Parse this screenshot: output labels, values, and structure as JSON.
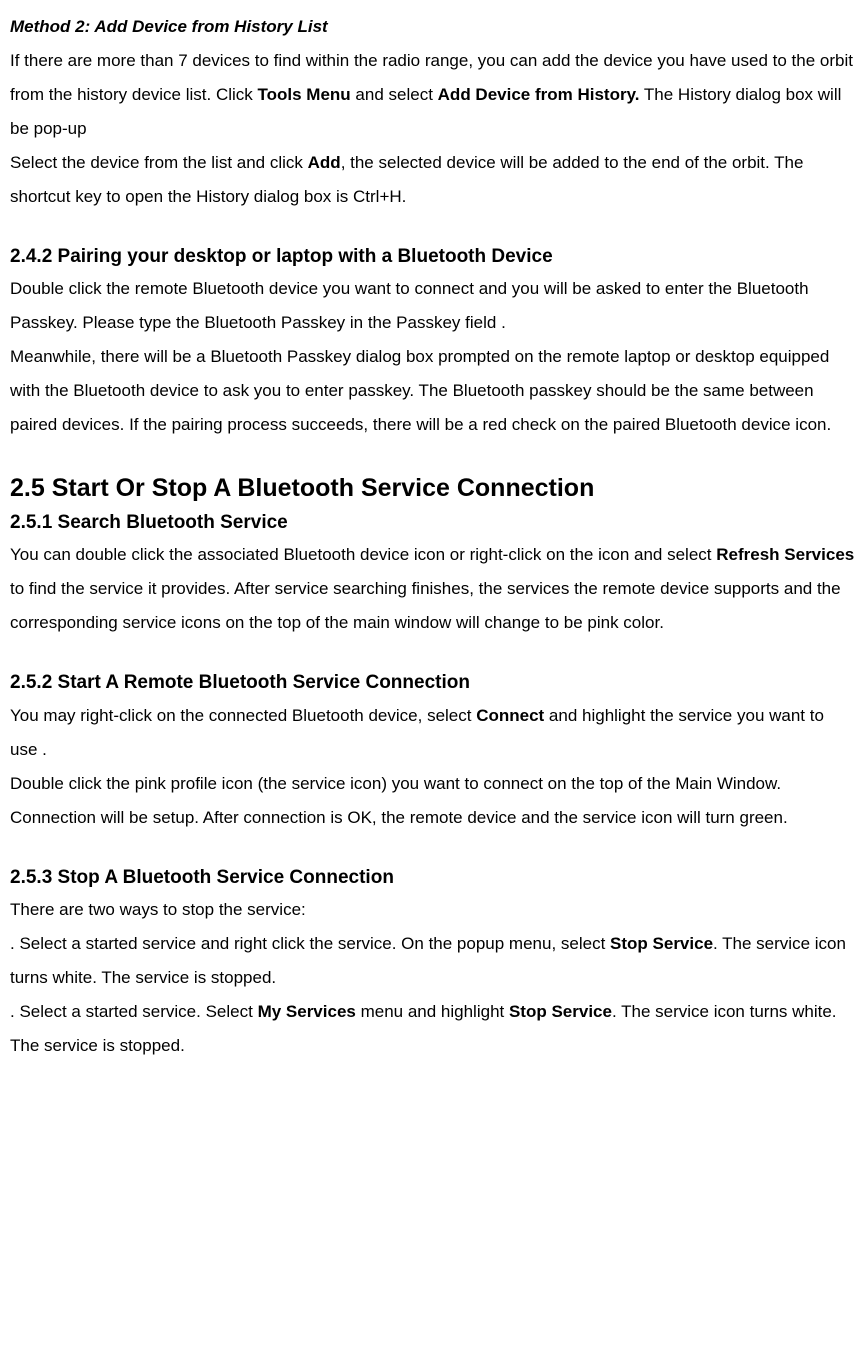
{
  "doc": {
    "method2_h": "Method 2: Add Device from History List",
    "method2_p1_a": "If there are more than 7 devices to find within the radio range, you can add the device you have used to the orbit from the history device list. Click ",
    "method2_p1_b": "Tools Menu",
    "method2_p1_c": " and select ",
    "method2_p1_d": "Add Device from History.",
    "method2_p1_e": " The History dialog box will be pop-up",
    "method2_p2_a": "Select the device from the list and click ",
    "method2_p2_b": "Add",
    "method2_p2_c": ", the selected device will be added to the end of the orbit. The shortcut key to open the History dialog box is Ctrl+H.",
    "s242_h": "2.4.2 Pairing your desktop or laptop with a Bluetooth Device",
    "s242_p1": "Double click the remote Bluetooth device you want to connect and you will be asked to enter the Bluetooth Passkey. Please type the Bluetooth Passkey in the Passkey field .",
    "s242_p2": "Meanwhile, there will be a Bluetooth Passkey dialog box prompted on the remote laptop or desktop equipped with the Bluetooth device to ask you to enter passkey. The Bluetooth passkey should be the same between paired devices. If the pairing process succeeds, there will be a red check on the paired Bluetooth device icon.",
    "s25_h": "2.5 Start Or Stop A Bluetooth Service Connection",
    "s251_h": "2.5.1 Search Bluetooth Service",
    "s251_p1_a": "You can double click the associated Bluetooth device icon or right-click on the icon and select ",
    "s251_p1_b": "Refresh Services",
    "s251_p1_c": " to find the service it provides. After service searching finishes, the services the remote device supports and the corresponding service icons on the top of the main window will change to be pink color.",
    "s252_h": "2.5.2 Start A Remote Bluetooth Service Connection",
    "s252_p1_a": "You may right-click on the connected Bluetooth device, select ",
    "s252_p1_b": "Connect",
    "s252_p1_c": " and highlight the service you want to use .",
    "s252_p2": "Double click the pink profile icon (the service icon) you want to connect on the top of the Main Window.",
    "s252_p3": "Connection will be setup. After connection is OK, the remote device and the service icon will turn green.",
    "s253_h": "2.5.3 Stop A Bluetooth Service Connection",
    "s253_p1": "There are two ways to stop the service:",
    "s253_li1_a": ".  Select a started service and right click the service. On the popup menu, select ",
    "s253_li1_b": "Stop Service",
    "s253_li1_c": ". The service icon turns white. The service is stopped.",
    "s253_li2_a": ".  Select a started service. Select ",
    "s253_li2_b": "My Services",
    "s253_li2_c": " menu and highlight ",
    "s253_li2_d": "Stop Service",
    "s253_li2_e": ". The service icon turns white. The service is stopped."
  }
}
